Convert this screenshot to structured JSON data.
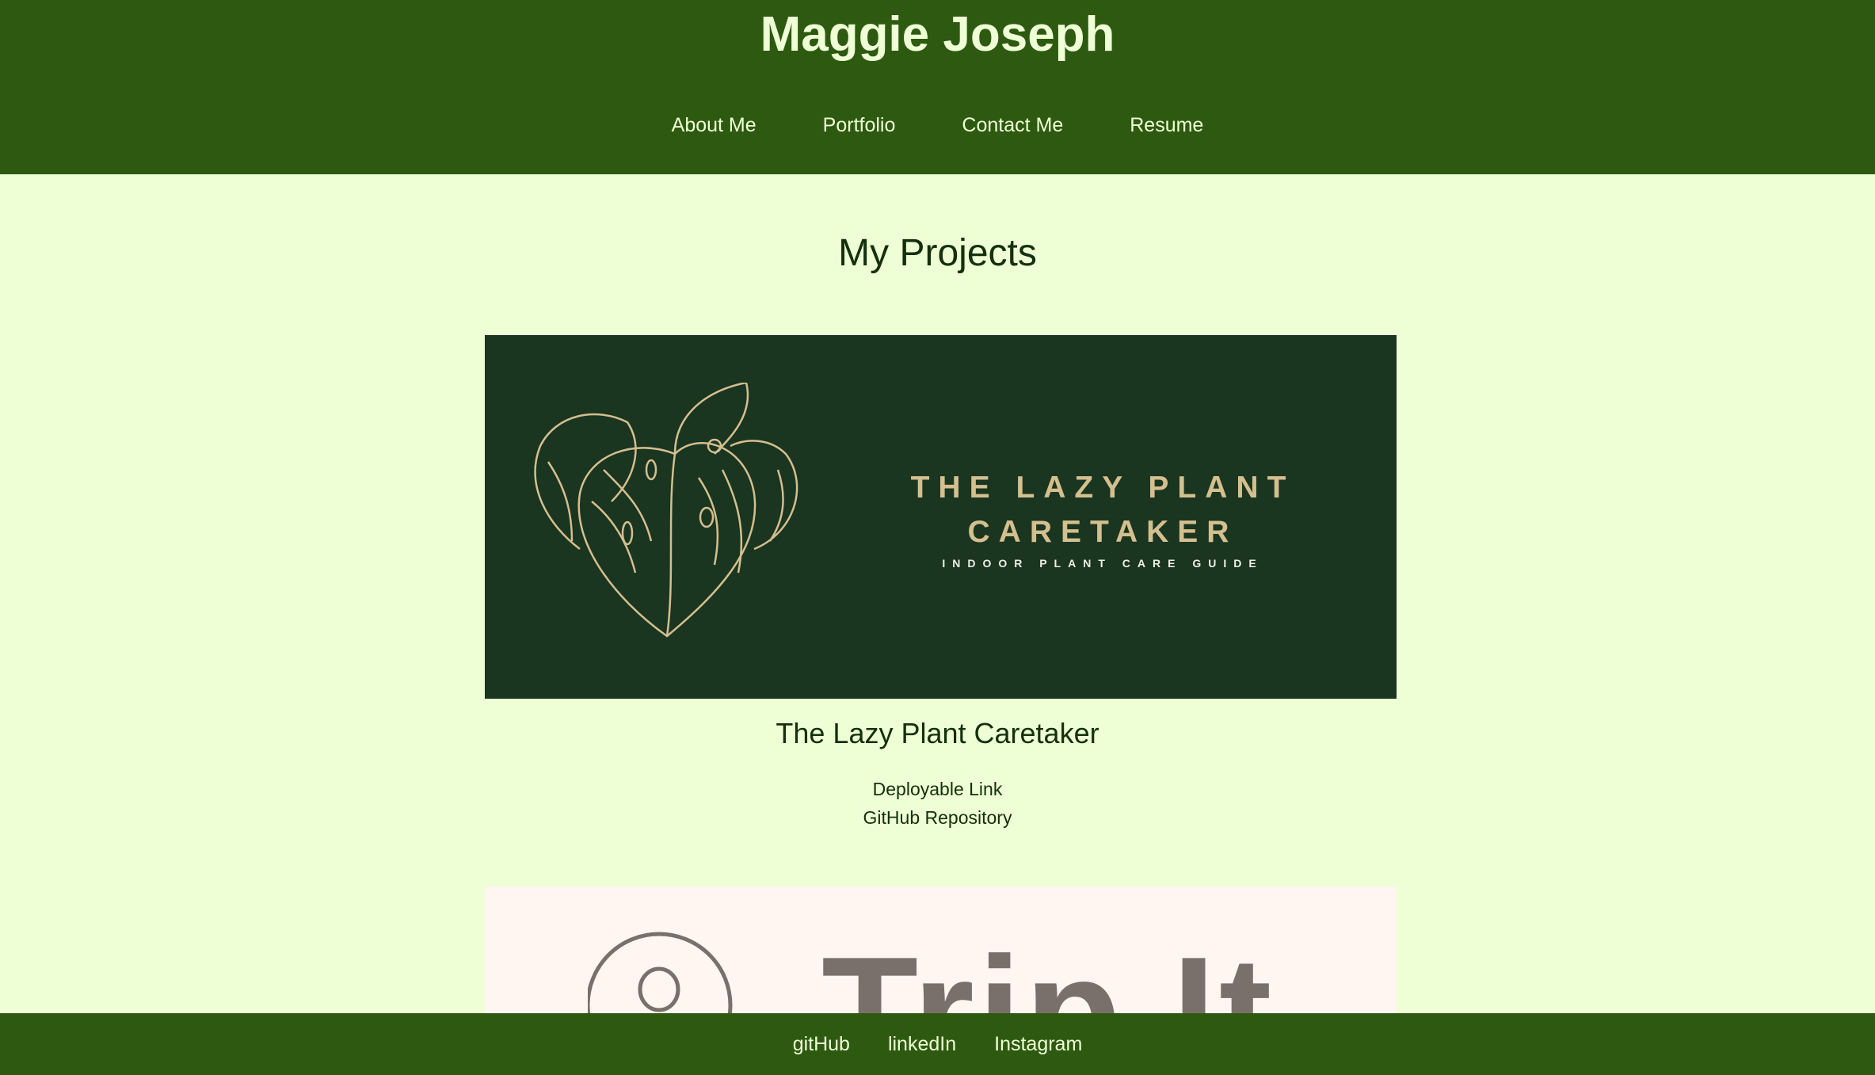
{
  "header": {
    "title": "Maggie Joseph",
    "nav": [
      "About Me",
      "Portfolio",
      "Contact Me",
      "Resume"
    ]
  },
  "main": {
    "heading": "My Projects",
    "projects": [
      {
        "image_title_line1": "THE LAZY PLANT",
        "image_title_line2": "CARETAKER",
        "image_subtitle": "INDOOR PLANT CARE GUIDE",
        "title": "The Lazy Plant Caretaker",
        "deploy_link": "Deployable Link",
        "repo_link": "GitHub Repository"
      },
      {
        "image_title": "Trip It"
      }
    ]
  },
  "footer": {
    "links": [
      "gitHub",
      "linkedIn",
      "Instagram"
    ]
  },
  "colors": {
    "header": "#2d5a10",
    "background": "#eeffd6",
    "image_bg": "#1a3520",
    "gold": "#d4bf8f"
  }
}
